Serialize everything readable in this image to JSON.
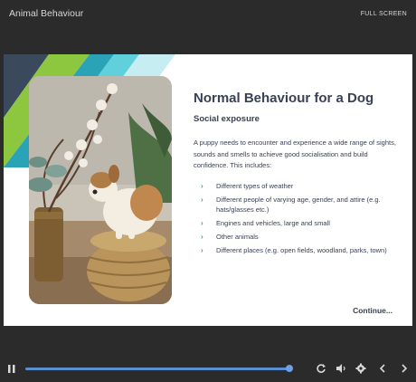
{
  "window": {
    "title": "Animal Behaviour",
    "fullscreen_label": "FULL SCREEN"
  },
  "slide": {
    "heading": "Normal Behaviour for a Dog",
    "subheading": "Social exposure",
    "body": "A puppy needs to encounter and experience a wide range of sights, sounds and smells to achieve good socialisation and build confidence. This includes:",
    "bullets": [
      "Different types of weather",
      "Different people of varying age, gender, and attire (e.g. hats/glasses etc.)",
      "Engines and vehicles, large and small",
      "Other animals",
      "Different places (e.g. open fields, woodland, parks, town)"
    ],
    "continue_label": "Continue...",
    "image": "puppy sitting on a wicker basket next to a vase of cotton flowers"
  },
  "player": {
    "progress": 0.99
  },
  "icons": {
    "pause": "pause-icon",
    "replay": "replay-icon",
    "volume": "volume-icon",
    "settings": "gear-icon",
    "prev": "chevron-left-icon",
    "next": "chevron-right-icon"
  },
  "colors": {
    "heading": "#394154",
    "bullet_chevron": "#1aa6b7",
    "progress": "#5b8fd4",
    "deco_green": "#8dc63f",
    "deco_teal": "#2bbbcc",
    "deco_navy": "#3a4a5c"
  }
}
